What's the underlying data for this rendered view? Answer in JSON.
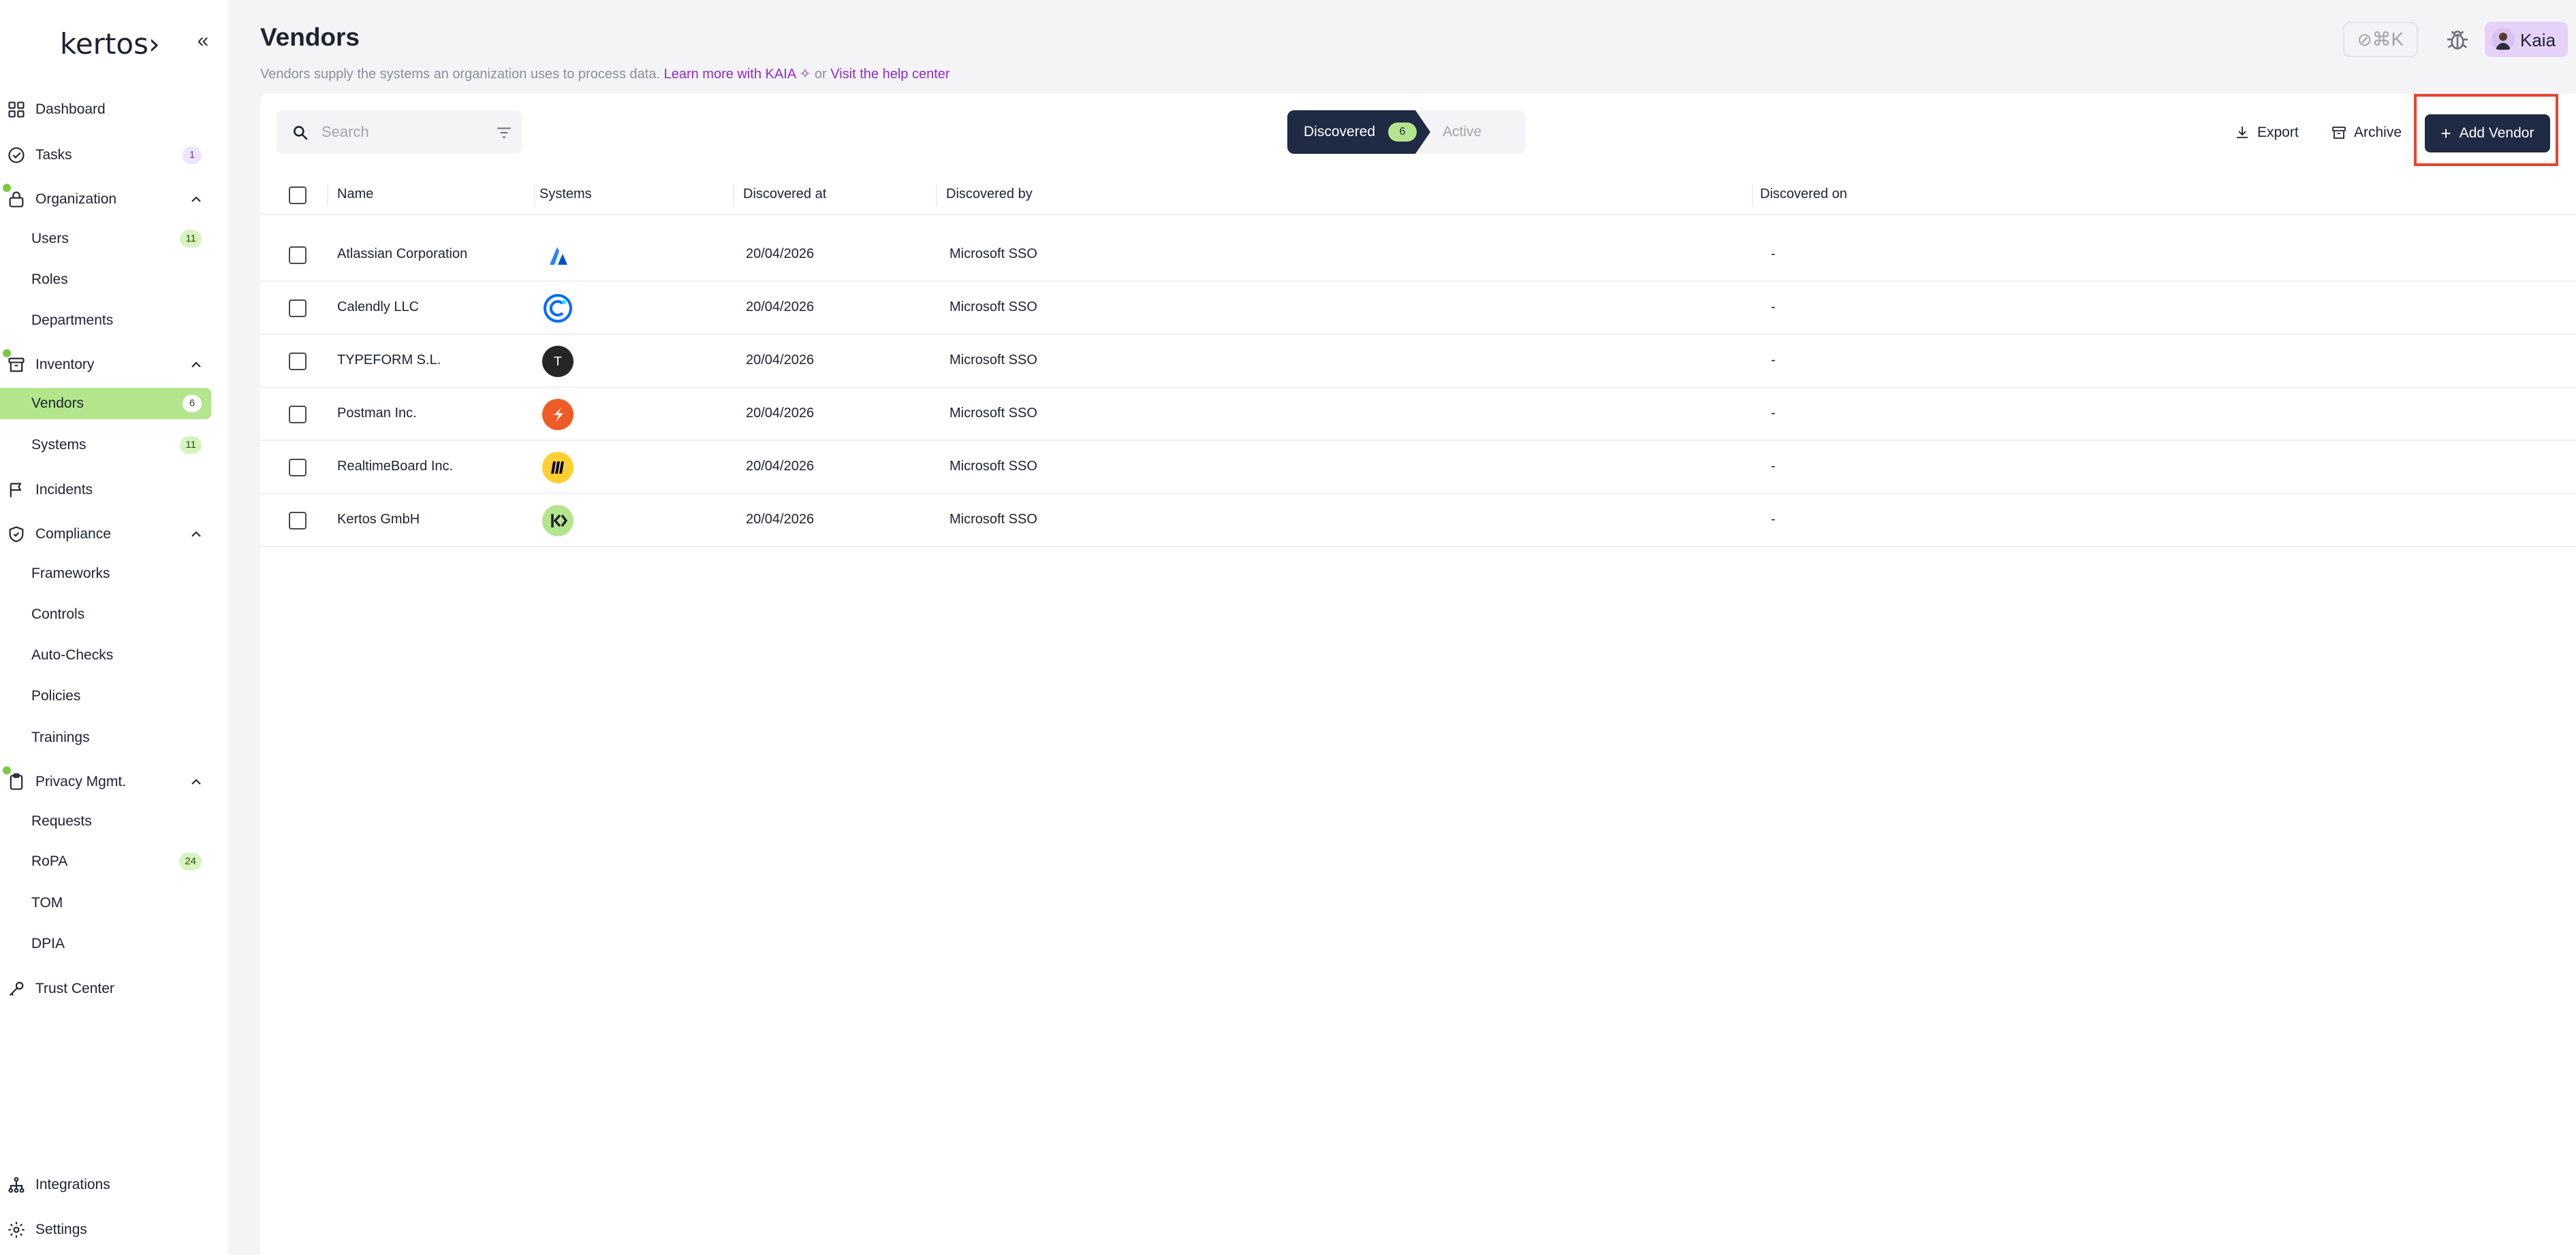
{
  "app": {
    "logo_text": "kertos"
  },
  "sidebar": {
    "items": [
      {
        "label": "Dashboard"
      },
      {
        "label": "Tasks",
        "badge": "1"
      },
      {
        "label": "Organization"
      },
      {
        "label": "Users",
        "badge": "11"
      },
      {
        "label": "Roles"
      },
      {
        "label": "Departments"
      },
      {
        "label": "Inventory"
      },
      {
        "label": "Vendors",
        "badge": "6"
      },
      {
        "label": "Systems",
        "badge": "11"
      },
      {
        "label": "Incidents"
      },
      {
        "label": "Compliance"
      },
      {
        "label": "Frameworks"
      },
      {
        "label": "Controls"
      },
      {
        "label": "Auto-Checks"
      },
      {
        "label": "Policies"
      },
      {
        "label": "Trainings"
      },
      {
        "label": "Privacy Mgmt."
      },
      {
        "label": "Requests"
      },
      {
        "label": "RoPA",
        "badge": "24"
      },
      {
        "label": "TOM"
      },
      {
        "label": "DPIA"
      },
      {
        "label": "Trust Center"
      },
      {
        "label": "Integrations"
      },
      {
        "label": "Settings"
      }
    ]
  },
  "header": {
    "title": "Vendors",
    "subtitle": "Vendors supply the systems an organization uses to process data.",
    "learn_more": "Learn more with KAIA",
    "or": "or",
    "help_link": "Visit the help center",
    "shortcut": "⌘K",
    "user_name": "Kaia"
  },
  "toolbar": {
    "search_placeholder": "Search",
    "tab_discovered": "Discovered",
    "tab_discovered_count": "6",
    "tab_active": "Active",
    "export_label": "Export",
    "archive_label": "Archive",
    "add_label": "Add Vendor"
  },
  "table": {
    "columns": [
      "Name",
      "Systems",
      "Discovered at",
      "Discovered by",
      "Discovered on"
    ],
    "rows": [
      {
        "name": "Atlassian Corporation",
        "system_icon": "atlassian-logo-icon",
        "discovered_at": "20/04/2026",
        "discovered_by": "Microsoft SSO",
        "discovered_on": "-"
      },
      {
        "name": "Calendly LLC",
        "system_icon": "calendly-logo-icon",
        "discovered_at": "20/04/2026",
        "discovered_by": "Microsoft SSO",
        "discovered_on": "-"
      },
      {
        "name": "TYPEFORM S.L.",
        "system_icon": "typeform-logo-icon",
        "discovered_at": "20/04/2026",
        "discovered_by": "Microsoft SSO",
        "discovered_on": "-"
      },
      {
        "name": "Postman Inc.",
        "system_icon": "postman-logo-icon",
        "discovered_at": "20/04/2026",
        "discovered_by": "Microsoft SSO",
        "discovered_on": "-"
      },
      {
        "name": "RealtimeBoard Inc.",
        "system_icon": "miro-logo-icon",
        "discovered_at": "20/04/2026",
        "discovered_by": "Microsoft SSO",
        "discovered_on": "-"
      },
      {
        "name": "Kertos GmbH",
        "system_icon": "kertos-logo-icon",
        "discovered_at": "20/04/2026",
        "discovered_by": "Microsoft SSO",
        "discovered_on": "-"
      }
    ],
    "typeform_letter": "T"
  },
  "colors": {
    "accent_green": "#b3e58c",
    "primary_dark": "#1f2a44",
    "link_purple": "#8c2bcf",
    "highlight_red": "#e8432f"
  }
}
